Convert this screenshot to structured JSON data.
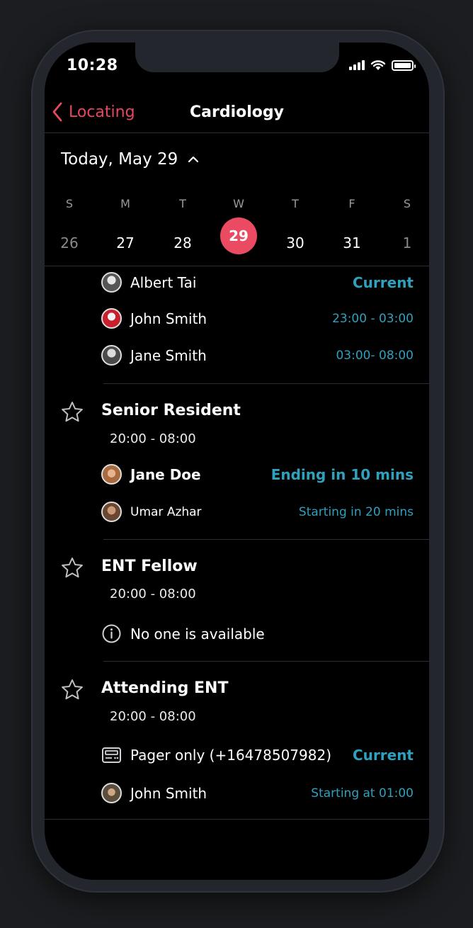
{
  "status_bar": {
    "time": "10:28"
  },
  "nav": {
    "back_label": "Locating",
    "title": "Cardiology"
  },
  "date_header": {
    "label": "Today, May 29"
  },
  "week": [
    {
      "letter": "S",
      "num": "26",
      "muted": true
    },
    {
      "letter": "M",
      "num": "27"
    },
    {
      "letter": "T",
      "num": "28"
    },
    {
      "letter": "W",
      "num": "29",
      "selected": true
    },
    {
      "letter": "T",
      "num": "30"
    },
    {
      "letter": "F",
      "num": "31"
    },
    {
      "letter": "S",
      "num": "1",
      "muted": true
    }
  ],
  "first_group": {
    "rows": [
      {
        "name": "Albert Tai",
        "status": "Current"
      },
      {
        "name": "John Smith",
        "status": "23:00 - 03:00"
      },
      {
        "name": "Jane Smith",
        "status": "03:00- 08:00"
      }
    ]
  },
  "groups": [
    {
      "title": "Senior Resident",
      "time": "20:00 - 08:00",
      "rows": [
        {
          "name": "Jane Doe",
          "status": "Ending in 10 mins"
        },
        {
          "name": "Umar Azhar",
          "status": "Starting in 20 mins"
        }
      ]
    },
    {
      "title": "ENT Fellow",
      "time": "20:00 - 08:00",
      "rows": [
        {
          "name": "No one is available",
          "icon": "info-icon"
        }
      ]
    },
    {
      "title": "Attending ENT",
      "time": "20:00 - 08:00",
      "rows": [
        {
          "name": "Pager only (+16478507982)",
          "status": "Current",
          "icon": "pager-icon"
        },
        {
          "name": "John Smith",
          "status": "Starting at 01:00"
        }
      ]
    }
  ],
  "colors": {
    "accent": "#e8475e",
    "status": "#2fa0bd",
    "background": "#000000"
  }
}
